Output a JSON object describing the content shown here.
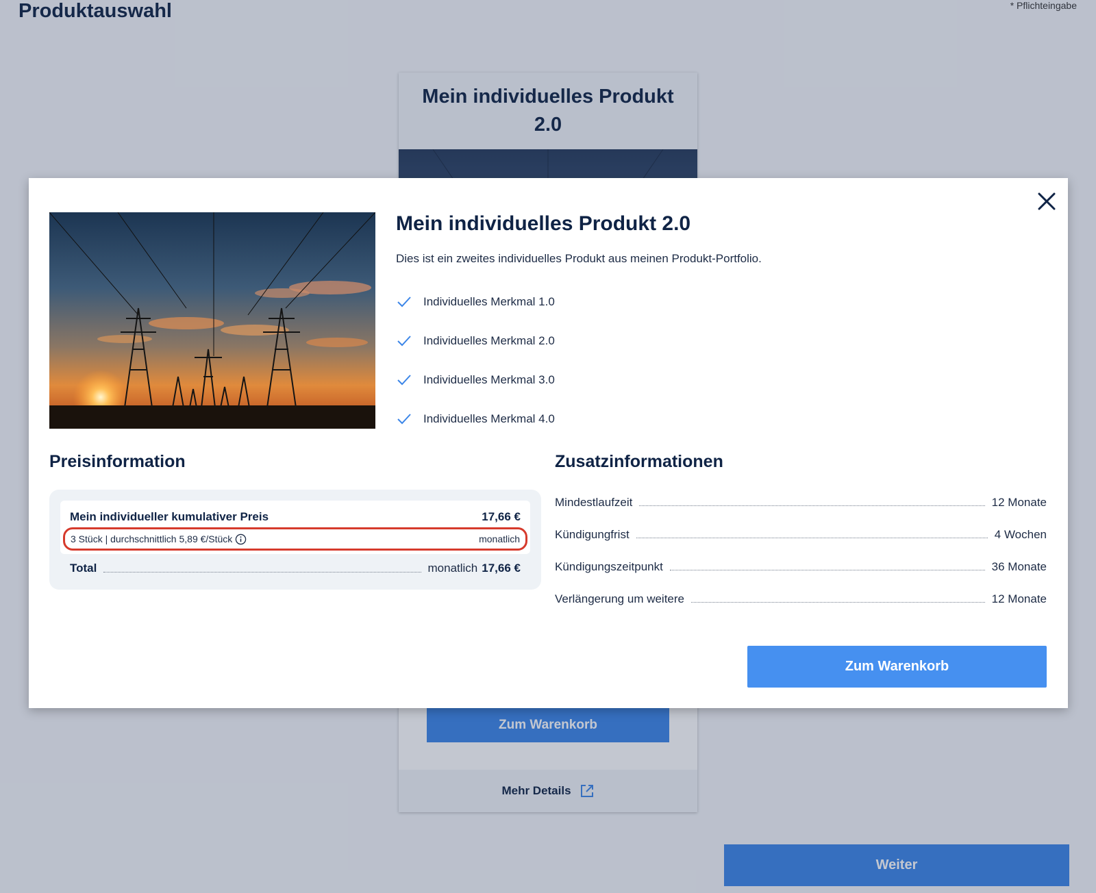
{
  "page": {
    "title": "Produktauswahl",
    "required_note": "* Pflichteingabe"
  },
  "background_card": {
    "title": "Mein individuelles Produkt 2.0",
    "cart_button": "Zum Warenkorb",
    "more_details": "Mehr Details"
  },
  "next_button": "Weiter",
  "modal": {
    "product_title": "Mein individuelles Produkt 2.0",
    "description": "Dies ist ein zweites individuelles Produkt aus meinen Produkt-Portfolio.",
    "features": [
      "Individuelles Merkmal 1.0",
      "Individuelles Merkmal 2.0",
      "Individuelles Merkmal 3.0",
      "Individuelles Merkmal 4.0"
    ],
    "price_section": {
      "heading": "Preisinformation",
      "item_name": "Mein individueller kumulativer Preis",
      "item_price": "17,66 €",
      "item_detail": "3 Stück | durchschnittlich 5,89 €/Stück",
      "item_interval": "monatlich",
      "total_label": "Total",
      "total_interval": "monatlich",
      "total_amount": "17,66 €"
    },
    "extra_section": {
      "heading": "Zusatzinformationen",
      "rows": [
        {
          "label": "Mindestlaufzeit",
          "value": "12 Monate"
        },
        {
          "label": "Kündigungfrist",
          "value": "4 Wochen"
        },
        {
          "label": "Kündigungszeitpunkt",
          "value": "36 Monate"
        },
        {
          "label": "Verlängerung um weitere",
          "value": "12 Monate"
        }
      ]
    },
    "cart_button": "Zum Warenkorb"
  },
  "colors": {
    "primary_blue": "#4690f0",
    "navy_text": "#0f2345",
    "highlight_red": "#d63a2c",
    "check_blue": "#3c86e8"
  }
}
